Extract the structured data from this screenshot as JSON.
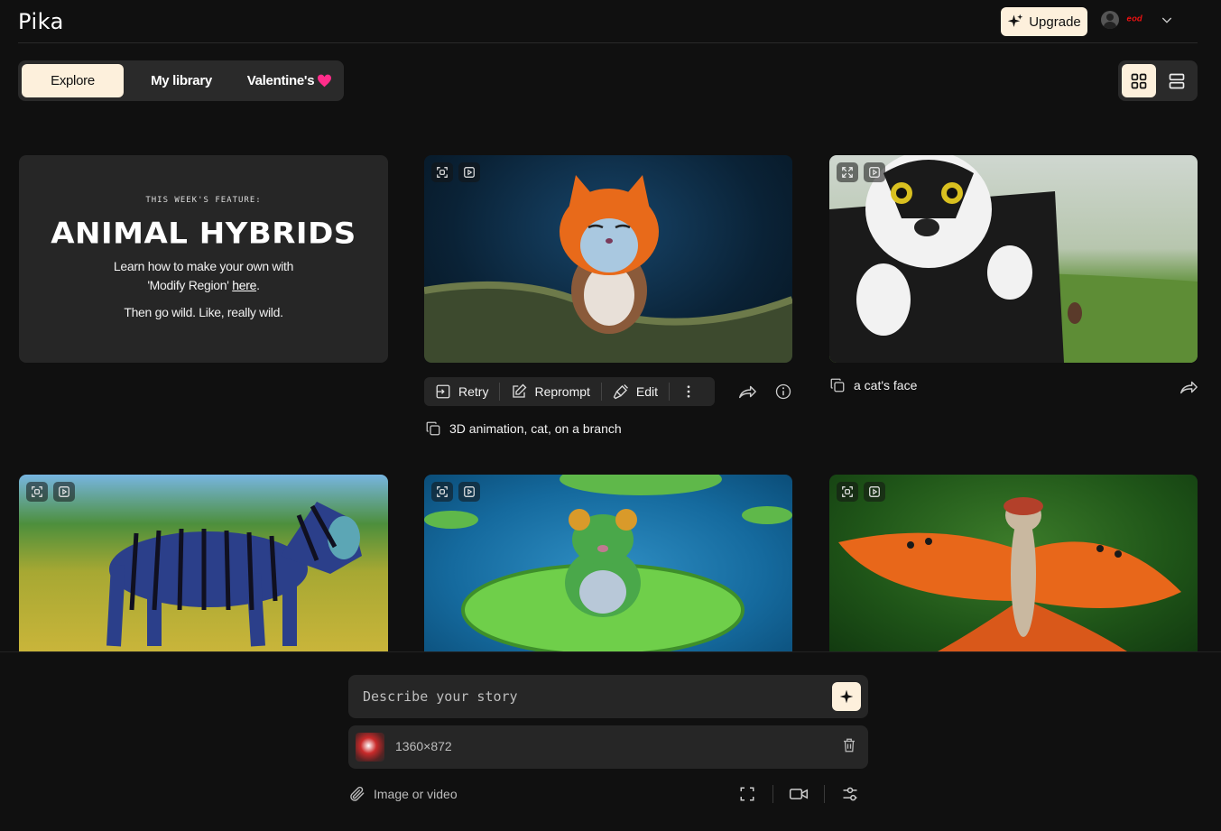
{
  "header": {
    "logo": "Pika",
    "upgrade_label": "Upgrade",
    "username": "ᵉᵒᵈ",
    "icons": [
      "sparkle-icon",
      "avatar",
      "chevron-down-icon"
    ]
  },
  "tabs": [
    {
      "label": "Explore",
      "active": true
    },
    {
      "label": "My library",
      "active": false
    },
    {
      "label": "Valentine's",
      "active": false,
      "icon": "heart-icon"
    }
  ],
  "view_toggle": {
    "active": "grid",
    "options": [
      "grid",
      "list"
    ]
  },
  "feature": {
    "kicker": "THIS WEEK'S FEATURE:",
    "title": "ANIMAL HYBRIDS",
    "line1": "Learn how to make your own with",
    "line2_prefix": "'Modify Region' ",
    "line2_link": "here",
    "line2_suffix": ".",
    "line3": "Then go wild. Like, really wild."
  },
  "card_actions": {
    "retry": "Retry",
    "reprompt": "Reprompt",
    "edit": "Edit"
  },
  "captions": {
    "cat_branch": "3D animation, cat, on a branch",
    "cat_face": "a cat's face"
  },
  "prompt": {
    "placeholder": "Describe your story",
    "attachment_size": "1360×872",
    "image_or_video": "Image or video"
  },
  "colors": {
    "accent": "#fdf0dc",
    "background": "#101010",
    "surface": "#262626",
    "heart": "#ff2d8a"
  }
}
